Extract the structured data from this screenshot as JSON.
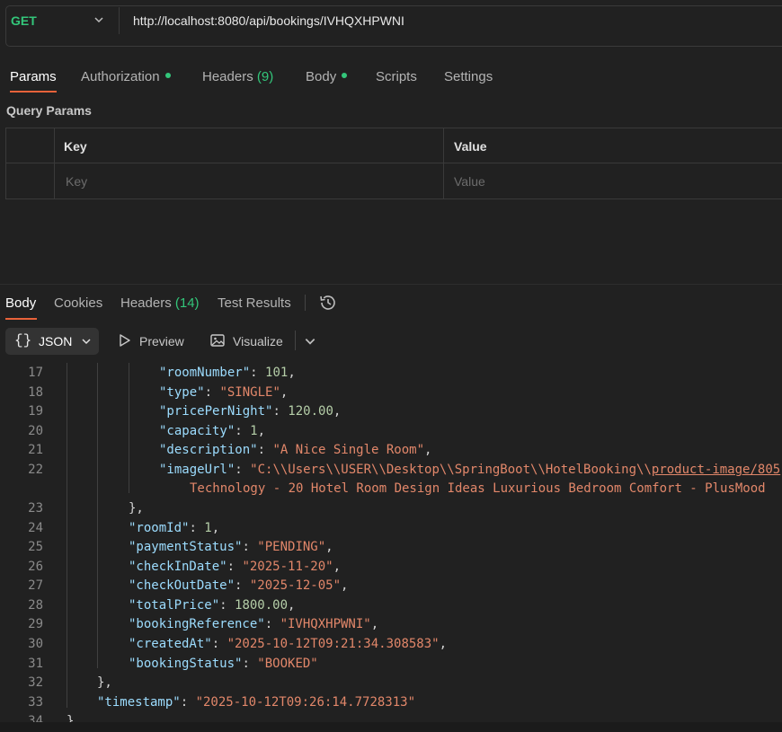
{
  "request": {
    "method": "GET",
    "url": "http://localhost:8080/api/bookings/IVHQXHPWNI"
  },
  "request_tabs": {
    "params": "Params",
    "authorization": "Authorization",
    "headers": "Headers",
    "headers_count": "(9)",
    "body": "Body",
    "scripts": "Scripts",
    "settings": "Settings"
  },
  "query_params": {
    "title": "Query Params",
    "col_key": "Key",
    "col_value": "Value",
    "key_placeholder": "Key",
    "value_placeholder": "Value"
  },
  "response_tabs": {
    "body": "Body",
    "cookies": "Cookies",
    "headers": "Headers",
    "headers_count": "(14)",
    "test_results": "Test Results"
  },
  "response_toolbar": {
    "format": "JSON",
    "preview": "Preview",
    "visualize": "Visualize"
  },
  "code": {
    "line_numbers": [
      "17",
      "18",
      "19",
      "20",
      "21",
      "22",
      "",
      "23",
      "24",
      "25",
      "26",
      "27",
      "28",
      "29",
      "30",
      "31",
      "32",
      "33",
      "34"
    ],
    "l17": {
      "key": "\"roomNumber\"",
      "val": "101"
    },
    "l18": {
      "key": "\"type\"",
      "val": "\"SINGLE\""
    },
    "l19": {
      "key": "\"pricePerNight\"",
      "val": "120.00"
    },
    "l20": {
      "key": "\"capacity\"",
      "val": "1"
    },
    "l21": {
      "key": "\"description\"",
      "val": "\"A Nice Single Room\""
    },
    "l22": {
      "key": "\"imageUrl\"",
      "val_a": "\"C:\\\\Users\\\\USER\\\\Desktop\\\\SpringBoot\\\\HotelBooking\\\\",
      "val_b": "product-image/805",
      "val_c": "Technology - 20 Hotel Room Design Ideas Luxurious Bedroom Comfort - PlusMood"
    },
    "l23": "},",
    "l24": {
      "key": "\"roomId\"",
      "val": "1"
    },
    "l25": {
      "key": "\"paymentStatus\"",
      "val": "\"PENDING\""
    },
    "l26": {
      "key": "\"checkInDate\"",
      "val": "\"2025-11-20\""
    },
    "l27": {
      "key": "\"checkOutDate\"",
      "val": "\"2025-12-05\""
    },
    "l28": {
      "key": "\"totalPrice\"",
      "val": "1800.00"
    },
    "l29": {
      "key": "\"bookingReference\"",
      "val": "\"IVHQXHPWNI\""
    },
    "l30": {
      "key": "\"createdAt\"",
      "val": "\"2025-10-12T09:21:34.308583\""
    },
    "l31": {
      "key": "\"bookingStatus\"",
      "val": "\"BOOKED\""
    },
    "l32": "},",
    "l33": {
      "key": "\"timestamp\"",
      "val": "\"2025-10-12T09:26:14.7728313\""
    },
    "l34": "}"
  },
  "colors": {
    "accent": "#e8623a",
    "method_get": "#33c67a",
    "json_key": "#9cdcfe",
    "json_string": "#e2876a",
    "json_number": "#b5cea8"
  },
  "icons": [
    "chevron-down-icon",
    "history-icon",
    "braces-icon",
    "play-icon",
    "image-icon"
  ]
}
